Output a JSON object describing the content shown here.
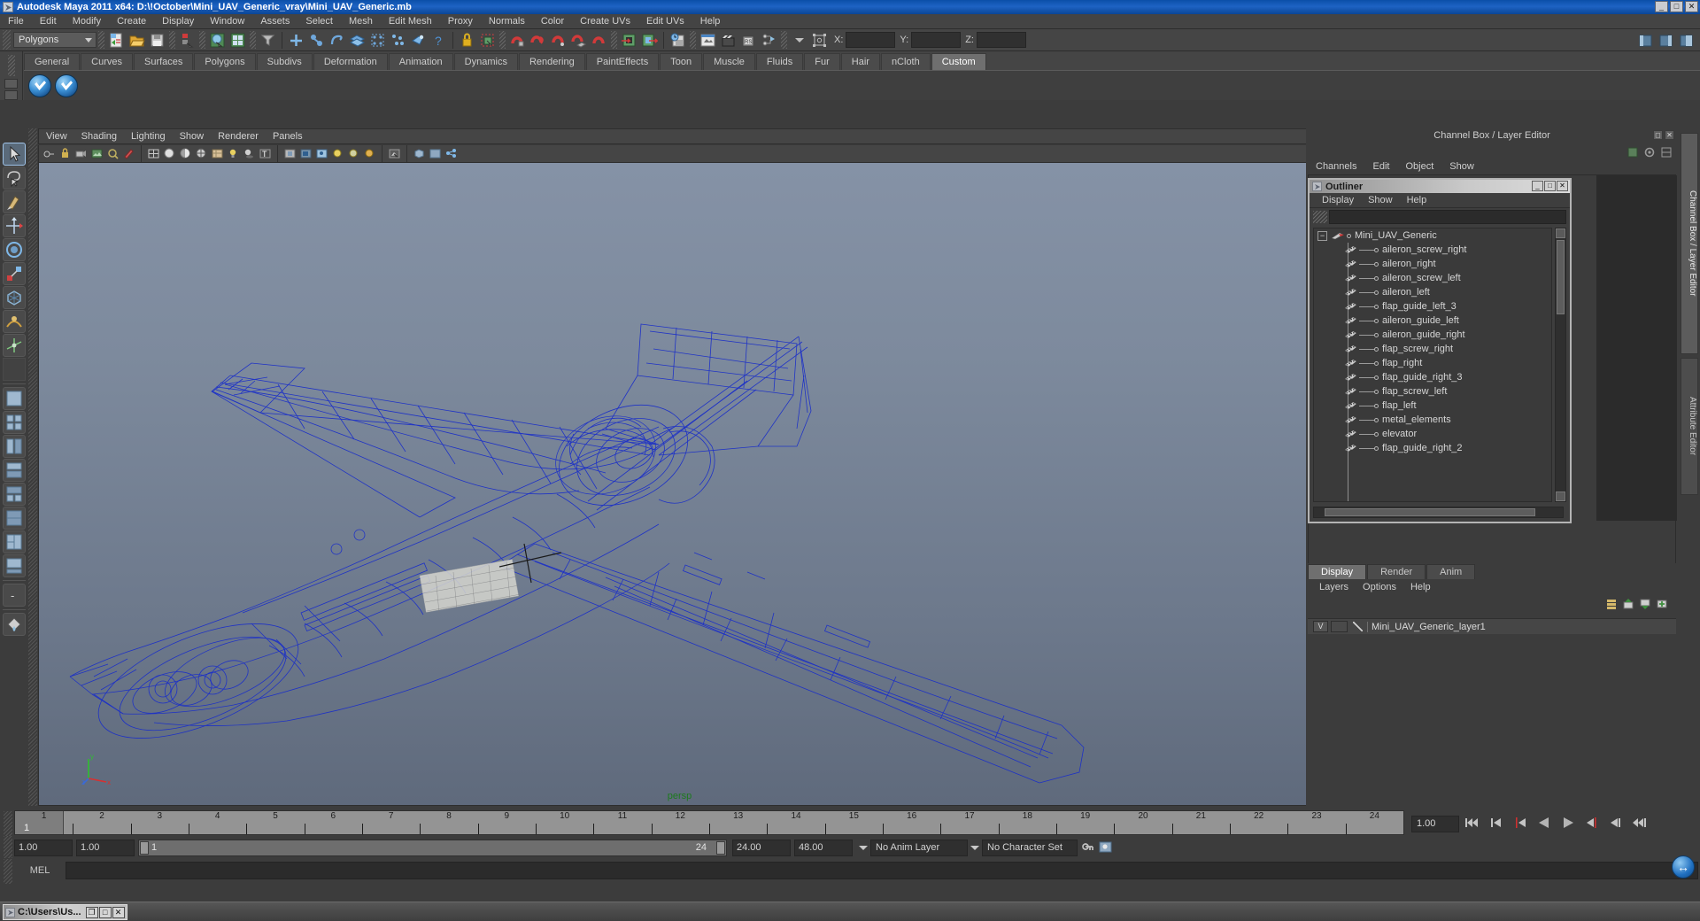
{
  "window": {
    "title": "Autodesk Maya 2011 x64: D:\\!October\\Mini_UAV_Generic_vray\\Mini_UAV_Generic.mb",
    "minimize": "_",
    "maximize": "□",
    "close": "✕"
  },
  "menubar": [
    "File",
    "Edit",
    "Modify",
    "Create",
    "Display",
    "Window",
    "Assets",
    "Select",
    "Mesh",
    "Edit Mesh",
    "Proxy",
    "Normals",
    "Color",
    "Create UVs",
    "Edit UVs",
    "Help"
  ],
  "statusbar": {
    "mode": "Polygons",
    "x_label": "X:",
    "y_label": "Y:",
    "z_label": "Z:",
    "x_value": "",
    "y_value": "",
    "z_value": ""
  },
  "shelf": {
    "tabs": [
      "General",
      "Curves",
      "Surfaces",
      "Polygons",
      "Subdivs",
      "Deformation",
      "Animation",
      "Dynamics",
      "Rendering",
      "PaintEffects",
      "Toon",
      "Muscle",
      "Fluids",
      "Fur",
      "Hair",
      "nCloth",
      "Custom"
    ],
    "active": "Custom",
    "items": [
      "check-shelf-icon",
      "check-shelf-icon"
    ]
  },
  "viewport": {
    "menus": [
      "View",
      "Shading",
      "Lighting",
      "Show",
      "Renderer",
      "Panels"
    ],
    "camera_label": "persp",
    "axis": {
      "x": "x",
      "y": "y",
      "z": "z"
    }
  },
  "channelbox": {
    "title": "Channel Box / Layer Editor",
    "menus": [
      "Channels",
      "Edit",
      "Object",
      "Show"
    ]
  },
  "outliner": {
    "title": "Outliner",
    "minimize": "_",
    "maximize": "□",
    "close": "✕",
    "menus": [
      "Display",
      "Show",
      "Help"
    ],
    "search_value": "",
    "root": {
      "label": "Mini_UAV_Generic",
      "expand": "−"
    },
    "items": [
      "aileron_screw_right",
      "aileron_right",
      "aileron_screw_left",
      "aileron_left",
      "flap_guide_left_3",
      "aileron_guide_left",
      "aileron_guide_right",
      "flap_screw_right",
      "flap_right",
      "flap_guide_right_3",
      "flap_screw_left",
      "flap_left",
      "metal_elements",
      "elevator",
      "flap_guide_right_2"
    ]
  },
  "layereditor": {
    "tabs": [
      "Display",
      "Render",
      "Anim"
    ],
    "active_tab": "Display",
    "menus": [
      "Layers",
      "Options",
      "Help"
    ],
    "layers": [
      {
        "visibility": "V",
        "name": "Mini_UAV_Generic_layer1"
      }
    ]
  },
  "right_tabs": [
    {
      "label": "Channel Box / Layer Editor",
      "active": true
    },
    {
      "label": "Attribute Editor",
      "active": false
    }
  ],
  "timeslider": {
    "frames": [
      1,
      2,
      3,
      4,
      5,
      6,
      7,
      8,
      9,
      10,
      11,
      12,
      13,
      14,
      15,
      16,
      17,
      18,
      19,
      20,
      21,
      22,
      23,
      24
    ],
    "current_frame": "1",
    "current_field": "1.00",
    "playback_buttons": [
      "go-to-start",
      "step-back-key",
      "step-back-frame",
      "play-backwards",
      "play-forwards",
      "step-forward-frame",
      "step-forward-key",
      "go-to-end"
    ]
  },
  "rangeslider": {
    "start_field": "1.00",
    "end_field": "1.00",
    "range_start": "1",
    "range_end": "24",
    "anim_start": "24.00",
    "anim_end": "48.00",
    "anim_layer": "No Anim Layer",
    "character_set": "No Character Set"
  },
  "commandline": {
    "label": "MEL",
    "value": ""
  },
  "taskbar": {
    "item_label": "C:\\Users\\Us...",
    "restore": "❐",
    "maximize": "□",
    "close": "✕"
  },
  "colors": {
    "title_blue": "#1e63c4",
    "ui_gray": "#3c3c3c",
    "panel_gray": "#454545",
    "wireframe_blue": "#1b2fc8",
    "viewport_top": "#8592a6",
    "viewport_bottom": "#5f6a7c",
    "persp_green": "#1d7a1d"
  }
}
